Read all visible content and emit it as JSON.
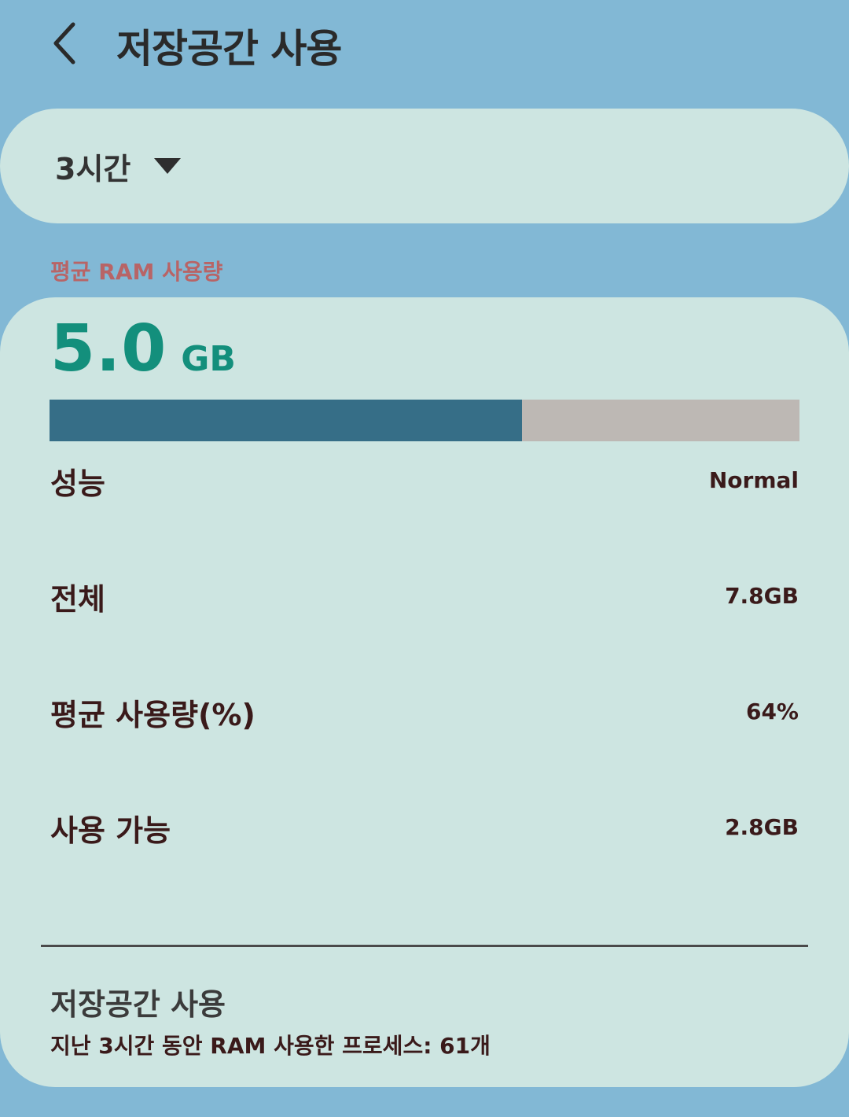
{
  "header": {
    "title": "저장공간 사용",
    "back_icon": "chevron-left-icon"
  },
  "period": {
    "selected": "3시간",
    "dropdown_icon": "triangle-down-icon"
  },
  "ram": {
    "section_label": "평균 RAM 사용량",
    "value": "5.0",
    "unit": "GB",
    "usage_fraction": 0.63,
    "colors": {
      "fill": "#366e87",
      "track": "#bdb8b4",
      "value_text": "#138f7c",
      "section_label": "#b86466"
    },
    "stats": [
      {
        "label": "성능",
        "value": "Normal"
      },
      {
        "label": "전체",
        "value": "7.8GB"
      },
      {
        "label": "평균 사용량(%)",
        "value": "64%"
      },
      {
        "label": "사용 가능",
        "value": "2.8GB"
      }
    ]
  },
  "footer": {
    "title": "저장공간 사용",
    "description": "지난 3시간 동안 RAM 사용한 프로세스: 61개"
  }
}
